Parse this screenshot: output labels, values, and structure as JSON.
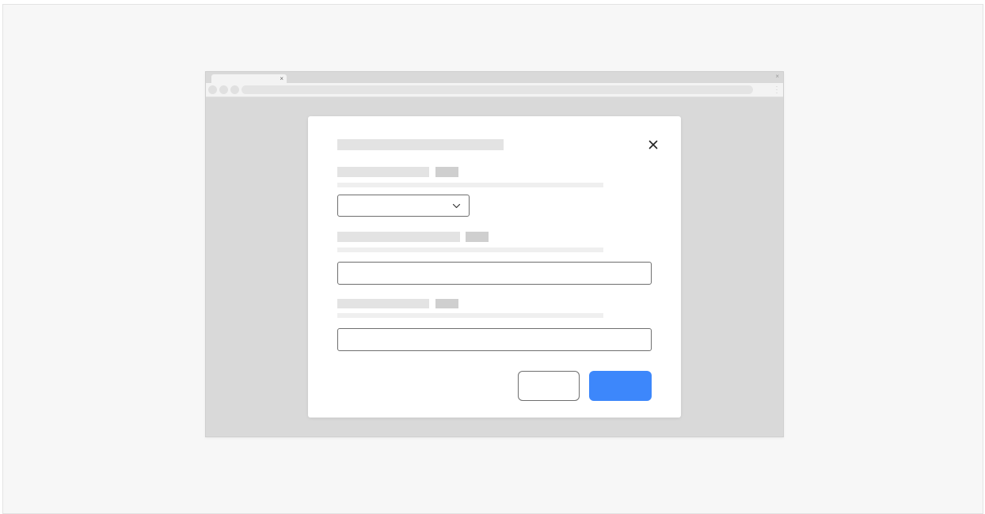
{
  "browser": {
    "tab": {
      "title": "",
      "close_icon": "close-icon"
    },
    "window_close_icon": "close-icon",
    "address_bar": {
      "url": ""
    },
    "menu_icon": "kebab-menu-icon"
  },
  "dialog": {
    "title": "",
    "close_icon": "close-icon",
    "fields": [
      {
        "label": "",
        "tag": "",
        "description": "",
        "control": "select",
        "value": "",
        "chevron_icon": "chevron-down-icon"
      },
      {
        "label": "",
        "tag": "",
        "description": "",
        "control": "text",
        "value": ""
      },
      {
        "label": "",
        "tag": "",
        "description": "",
        "control": "text",
        "value": ""
      }
    ],
    "buttons": {
      "cancel_label": "",
      "submit_label": ""
    }
  },
  "colors": {
    "primary": "#3d87fb",
    "overlay": "#d9d9d9",
    "placeholder_bar": "#e3e3e3",
    "placeholder_tag": "#cfcfcf",
    "border": "#6e6e6e",
    "page_background": "#f7f7f7"
  }
}
